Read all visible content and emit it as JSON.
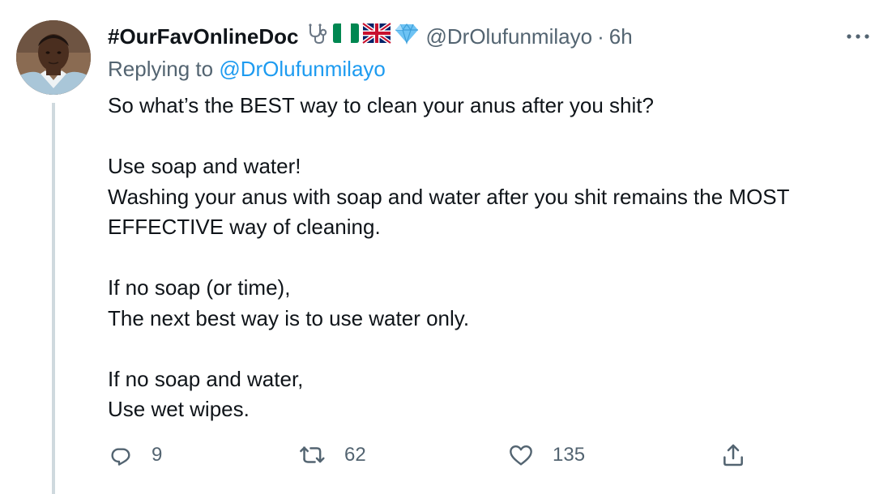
{
  "tweet": {
    "display_name": "#OurFavOnlineDoc",
    "badges": [
      "stethoscope-icon",
      "nigeria-flag-icon",
      "uk-flag-icon",
      "gem-icon"
    ],
    "handle": "@DrOlufunmilayo",
    "separator": "·",
    "time": "6h",
    "replying_prefix": "Replying to",
    "replying_handle": "@DrOlufunmilayo",
    "body_lines": [
      "So what’s the BEST way to clean your anus after you shit?",
      "",
      "Use soap and water!",
      "Washing your anus with soap and water after you shit remains the MOST",
      "EFFECTIVE way of cleaning.",
      "",
      "If no soap (or time),",
      "The next best way is to use water only.",
      "",
      "If no soap and water,",
      "Use wet wipes."
    ],
    "actions": {
      "reply_count": "9",
      "retweet_count": "62",
      "like_count": "135"
    }
  },
  "colors": {
    "text": "#0f1419",
    "secondary": "#536471",
    "link": "#1d9bf0",
    "thread_line": "#cfd9de"
  }
}
